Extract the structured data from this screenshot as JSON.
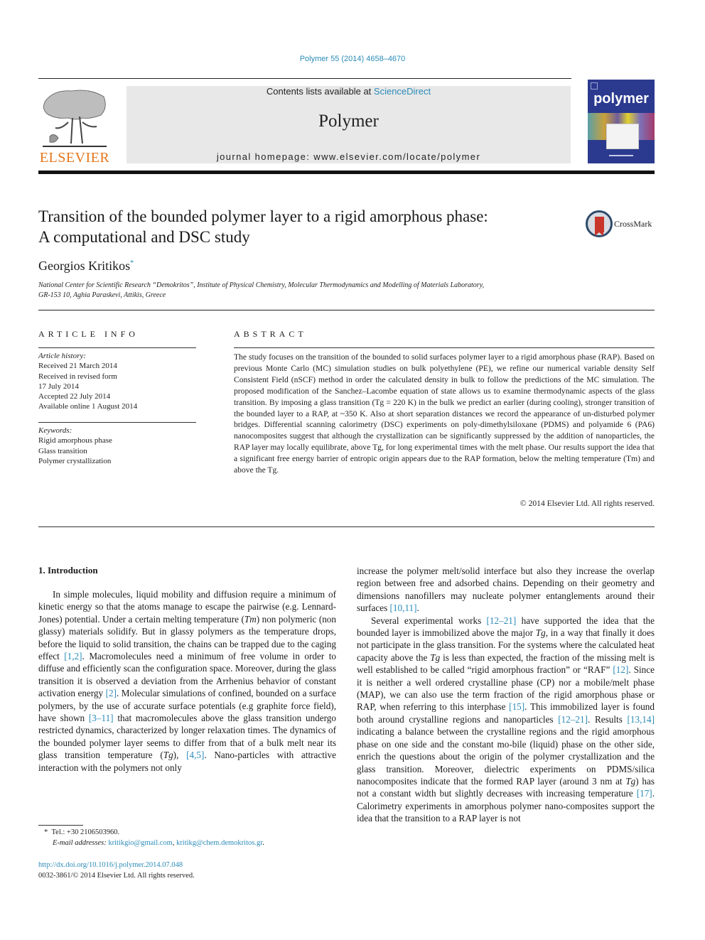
{
  "header": {
    "journal_reference": "Polymer 55 (2014) 4658–4670",
    "contents_prefix": "Contents lists available at ",
    "contents_link": "ScienceDirect",
    "journal_name": "Polymer",
    "homepage": "journal homepage: www.elsevier.com/locate/polymer",
    "publisher_logo_text": "ELSEVIER",
    "cover_title": "polymer",
    "crossmark_label": "CrossMark"
  },
  "article": {
    "title_line1": "Transition of the bounded polymer layer to a rigid amorphous phase:",
    "title_line2": "A computational and DSC study",
    "author": "Georgios Kritikos",
    "author_mark": "*",
    "affiliation_line1": "National Center for Scientific Research “Demokritos”, Institute of Physical Chemistry, Molecular Thermodynamics and Modelling of Materials Laboratory,",
    "affiliation_line2": "GR-153 10, Aghia Paraskevi, Attikis, Greece"
  },
  "article_info": {
    "heading": "ARTICLE INFO",
    "history_label": "Article history:",
    "history": [
      "Received 21 March 2014",
      "Received in revised form",
      "17 July 2014",
      "Accepted 22 July 2014",
      "Available online 1 August 2014"
    ],
    "keywords_label": "Keywords:",
    "keywords": [
      "Rigid amorphous phase",
      "Glass transition",
      "Polymer crystallization"
    ]
  },
  "abstract": {
    "heading": "ABSTRACT",
    "text": "The study focuses on the transition of the bounded to solid surfaces polymer layer to a rigid amorphous phase (RAP). Based on previous Monte Carlo (MC) simulation studies on bulk polyethylene (PE), we refine our numerical variable density Self Consistent Field (nSCF) method in order the calculated density in bulk to follow the predictions of the MC simulation. The proposed modification of the Sanchez–Lacombe equation of state allows us to examine thermodynamic aspects of the glass transition. By imposing a glass transition (Tg = 220 K) in the bulk we predict an earlier (during cooling), stronger transition of the bounded layer to a RAP, at ~350 K. Also at short separation distances we record the appearance of un-disturbed polymer bridges. Differential scanning calorimetry (DSC) experiments on poly-dimethylsiloxane (PDMS) and polyamide 6 (PA6) nanocomposites suggest that although the crystallization can be significantly suppressed by the addition of nanoparticles, the RAP layer may locally equilibrate, above Tg, for long experimental times with the melt phase. Our results support the idea that a significant free energy barrier of entropic origin appears due to the RAP formation, below the melting temperature (Tm) and above the Tg.",
    "copyright": "© 2014 Elsevier Ltd. All rights reserved."
  },
  "body": {
    "section_title": "1.  Introduction",
    "left_paragraph": {
      "p1": "In simple molecules, liquid mobility and diffusion require a minimum of kinetic energy so that the atoms manage to escape the pairwise (e.g. Lennard-Jones) potential. Under a certain melting temperature (",
      "Tm": "Tm",
      "p2": ") non polymeric (non glassy) materials solidify. But in glassy polymers as the temperature drops, before the liquid to solid transition, the chains can be trapped due to the caging effect ",
      "ref1": "[1,2]",
      "p3": ". Macromolecules need a minimum of free volume in order to diffuse and efficiently scan the configuration space. Moreover, during the glass transition it is observed a deviation from the Arrhenius behavior of constant activation energy ",
      "ref2": "[2]",
      "p4": ". Molecular simulations of confined, bounded on a surface polymers, by the use of accurate surface potentials (e.g graphite force field), have shown ",
      "ref3": "[3–11]",
      "p5": " that macromolecules above the glass transition undergo restricted dynamics, characterized by longer relaxation times. The dynamics of the bounded polymer layer seems to differ from that of a bulk melt near its glass transition temperature (",
      "Tg": "Tg",
      "p6": "), ",
      "ref4": "[4,5]",
      "p7": ". Nano-particles with attractive interaction with the polymers not only"
    },
    "right_paragraph1": {
      "p1": "increase the polymer melt/solid interface but also they increase the overlap region between free and adsorbed chains. Depending on their geometry and dimensions nanofillers may nucleate polymer entanglements around their surfaces ",
      "ref1": "[10,11]",
      "p2": "."
    },
    "right_paragraph2": {
      "p1": "Several experimental works ",
      "ref1": "[12–21]",
      "p2": " have supported the idea that the bounded layer is immobilized above the major ",
      "Tg1": "Tg",
      "p3": ", in a way that finally it does not participate in the glass transition. For the systems where the calculated heat capacity above the ",
      "Tg2": "Tg",
      "p4": " is less than expected, the fraction of the missing melt is well established to be called “rigid amorphous fraction” or “RAF” ",
      "ref2": "[12]",
      "p5": ". Since it is neither a well ordered crystalline phase (CP) nor a mobile/melt phase (MAP), we can also use the term fraction of the rigid amorphous phase or RAP, when referring to this interphase ",
      "ref3": "[15]",
      "p6": ". This immobilized layer is found both around crystalline regions and nanoparticles ",
      "ref4": "[12–21]",
      "p7": ". Results ",
      "ref5": "[13,14]",
      "p8": " indicating a balance between the crystalline regions and the rigid amorphous phase on one side and the constant mo-bile (liquid) phase on the other side, enrich the questions about the origin of the polymer crystallization and the glass transition. Moreover, dielectric experiments on PDMS/silica nanocomposites indicate that the formed RAP layer (around 3 nm at ",
      "Tg3": "Tg",
      "p9": ") has not a constant width but slightly decreases with increasing temperature ",
      "ref6": "[17]",
      "p10": ". Calorimetry experiments in amorphous polymer nano-composites support the idea that the transition to a RAP layer is not"
    }
  },
  "footnote": {
    "mark": "*",
    "tel": "Tel.: +30 2106503960.",
    "email_label": "E-mail addresses:",
    "email1": "kritikgio@gmail.com",
    "sep": ", ",
    "email2": "kritikg@chem.demokritos.gr",
    "end": "."
  },
  "footer": {
    "doi": "http://dx.doi.org/10.1016/j.polymer.2014.07.048",
    "issn": "0032-3861/© 2014 Elsevier Ltd. All rights reserved."
  }
}
